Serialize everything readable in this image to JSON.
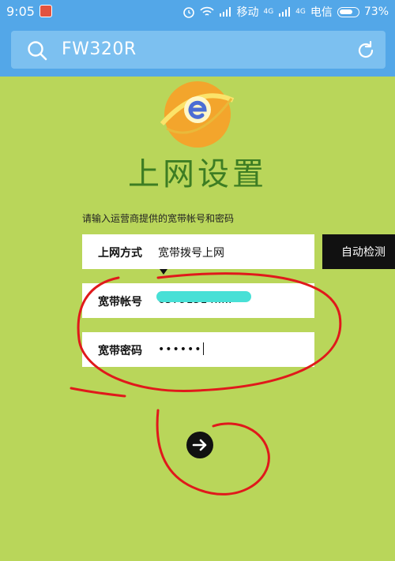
{
  "status_bar": {
    "time": "9:05",
    "carrier1": "移动",
    "carrier2": "电信",
    "battery": "73%",
    "net1": "4G",
    "net2": "4G",
    "icons": [
      "alarm-icon",
      "wifi-icon",
      "signal-icon",
      "battery-icon"
    ]
  },
  "search": {
    "query": "FW320R",
    "icons": [
      "search-icon",
      "refresh-icon"
    ]
  },
  "page": {
    "title": "上网设置",
    "hint": "请输入运营商提供的宽带帐号和密码"
  },
  "form": {
    "method_label": "上网方式",
    "method_value": "宽带拨号上网",
    "detect_button": "自动检测",
    "account_label": "宽带帐号",
    "account_value": "63791514.....",
    "password_label": "宽带密码",
    "password_value": "••••••"
  },
  "colors": {
    "background": "#b9d65a",
    "header": "#53a7e8",
    "title": "#3d7d23",
    "annotation": "#e0191b"
  }
}
